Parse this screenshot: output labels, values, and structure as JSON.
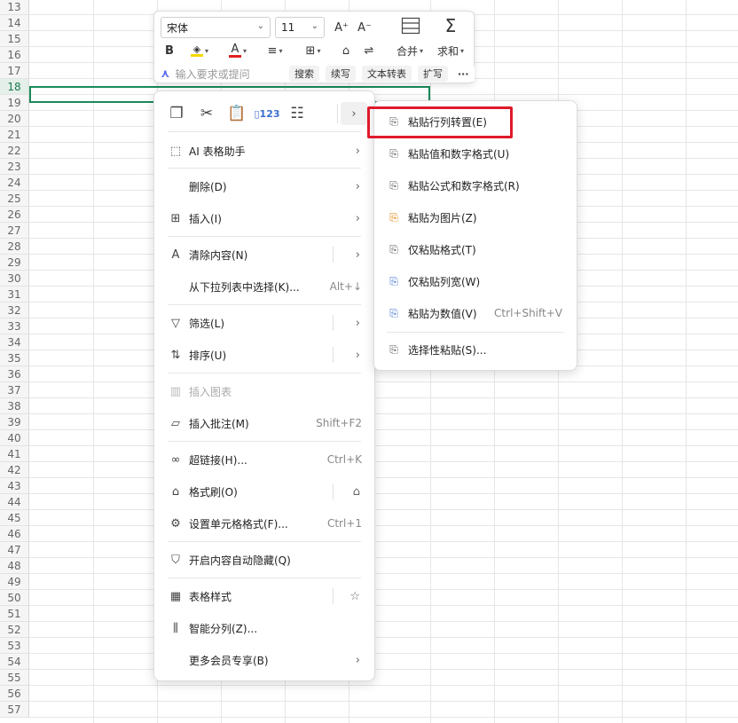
{
  "rows": [
    "13",
    "14",
    "15",
    "16",
    "17",
    "18",
    "19",
    "20",
    "21",
    "22",
    "23",
    "24",
    "25",
    "26",
    "27",
    "28",
    "29",
    "30",
    "31",
    "32",
    "33",
    "34",
    "35",
    "36",
    "37",
    "38",
    "39",
    "40",
    "41",
    "42",
    "43",
    "44",
    "45",
    "46",
    "47",
    "48",
    "49",
    "50",
    "51",
    "52",
    "53",
    "54",
    "55",
    "56",
    "57"
  ],
  "selected_row": "18",
  "toolbar": {
    "font_name": "宋体",
    "font_size": "11",
    "grow_font": "A⁺",
    "shrink_font": "A⁻",
    "bold": "B",
    "merge_label": "合并",
    "sum_label": "求和",
    "ai_placeholder": "输入要求或提问",
    "chips": [
      "搜索",
      "续写",
      "文本转表",
      "扩写"
    ],
    "more": "···",
    "accent_color": "#e02020"
  },
  "context_menu": {
    "ai_helper": "AI 表格助手",
    "delete": "删除(D)",
    "insert": "插入(I)",
    "clear": "清除内容(N)",
    "pick_list": "从下拉列表中选择(K)...",
    "pick_list_shortcut": "Alt+↓",
    "filter": "筛选(L)",
    "sort": "排序(U)",
    "insert_chart": "插入图表",
    "insert_comment": "插入批注(M)",
    "insert_comment_shortcut": "Shift+F2",
    "hyperlink": "超链接(H)...",
    "hyperlink_shortcut": "Ctrl+K",
    "format_painter": "格式刷(O)",
    "cell_format": "设置单元格格式(F)...",
    "cell_format_shortcut": "Ctrl+1",
    "auto_hide": "开启内容自动隐藏(Q)",
    "table_style": "表格样式",
    "smart_split": "智能分列(Z)...",
    "member": "更多会员专享(B)"
  },
  "paste_submenu": {
    "transpose": "粘贴行列转置(E)",
    "values_numfmt": "粘贴值和数字格式(U)",
    "formula_numfmt": "粘贴公式和数字格式(R)",
    "as_picture": "粘贴为图片(Z)",
    "format_only": "仅粘贴格式(T)",
    "col_width": "仅粘贴列宽(W)",
    "as_number": "粘贴为数值(V)",
    "as_number_shortcut": "Ctrl+Shift+V",
    "special": "选择性粘贴(S)..."
  }
}
